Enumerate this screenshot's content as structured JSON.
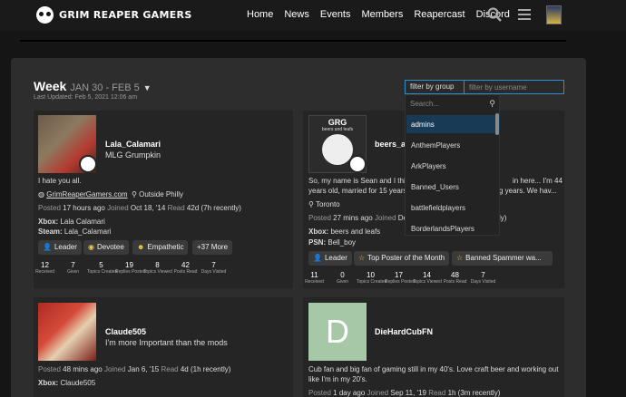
{
  "header": {
    "logo_text": "GRIM REAPER GAMERS",
    "nav": [
      "Home",
      "News",
      "Events",
      "Members",
      "Reapercast",
      "Discord"
    ]
  },
  "week": {
    "label": "Week",
    "range": "JAN 30 - FEB 5",
    "updated": "Last Updated: Feb 5, 2021 12:06 am"
  },
  "filters": {
    "group_label": "filter by group",
    "username_placeholder": "filter by username"
  },
  "dropdown": {
    "search_placeholder": "Search...",
    "items": [
      "admins",
      "AnthemPlayers",
      "ArkPlayers",
      "Banned_Users",
      "battlefieldplayers",
      "BorderlandsPlayers"
    ]
  },
  "cards": [
    {
      "name": "Lala_Calamari",
      "title": "MLG Grumpkin",
      "bio": "I hate you all.",
      "website": "GrimReaperGamers.com",
      "location": "Outside Philly",
      "posted_label": "Posted",
      "posted": "17 hours ago",
      "joined_label": "Joined",
      "joined": "Oct 18, '14",
      "read_label": "Read",
      "read": "42d (7h recently)",
      "xbox_label": "Xbox:",
      "xbox": "Lala Calamari",
      "steam_label": "Steam:",
      "steam": "Lala_Calamari",
      "badges": [
        "Leader",
        "Devotee",
        "Empathetic",
        "+37 More"
      ],
      "stats": [
        {
          "n": "12",
          "l": "Received"
        },
        {
          "n": "7",
          "l": "Given"
        },
        {
          "n": "5",
          "l": "Topics Created"
        },
        {
          "n": "19",
          "l": "Replies Posted"
        },
        {
          "n": "8",
          "l": "Topics Viewed"
        },
        {
          "n": "42",
          "l": "Posts Read"
        },
        {
          "n": "7",
          "l": "Days Visited"
        }
      ]
    },
    {
      "name": "beers_a",
      "avatar_text": "GRG",
      "avatar_subtext": "beers and leafs",
      "bio_line1_a": "So, my name is Sean and I thi",
      "bio_line1_b": "in here... I'm 44",
      "bio_line2_a": "years old, married for 15 years",
      "bio_line2_b": "g years. We hav...",
      "location": "Toronto",
      "posted_label": "Posted",
      "posted": "27 mins ago",
      "joined_label": "Joined",
      "joined_partial": "De",
      "read_partial": "ly)",
      "xbox_label": "Xbox:",
      "xbox": "beers and leafs",
      "psn_label": "PSN:",
      "psn": "Bell_boy",
      "badges": [
        "Leader",
        "Top Poster of the Month",
        "Banned Spammer wa..."
      ],
      "stats": [
        {
          "n": "11",
          "l": "Received"
        },
        {
          "n": "0",
          "l": "Given"
        },
        {
          "n": "10",
          "l": "Topics Created"
        },
        {
          "n": "17",
          "l": "Replies Posted"
        },
        {
          "n": "14",
          "l": "Topics Viewed"
        },
        {
          "n": "48",
          "l": "Posts Read"
        },
        {
          "n": "7",
          "l": "Days Visited"
        }
      ]
    },
    {
      "name": "Claude505",
      "title": "I'm more Important than the mods",
      "posted_label": "Posted",
      "posted": "48 mins ago",
      "joined_label": "Joined",
      "joined": "Jan 6, '15",
      "read_label": "Read",
      "read": "4d (1h recently)",
      "xbox_label": "Xbox:",
      "xbox": "Claude505"
    },
    {
      "name": "DieHardCubFN",
      "avatar_letter": "D",
      "bio_line1": "Cub fan and big fan of gaming still in my 40's. Love craft beer and working out",
      "bio_line2": "like I'm in my 20's.",
      "posted_label": "Posted",
      "posted": "1 day ago",
      "joined_label": "Joined",
      "joined": "Sep 11, '19",
      "read_label": "Read",
      "read": "1h (3m recently)"
    }
  ],
  "colors": {
    "accent": "#2d8fd0",
    "active_item": "#183a55",
    "page_bg": "#151515",
    "panel_bg": "#2d2d2d"
  }
}
